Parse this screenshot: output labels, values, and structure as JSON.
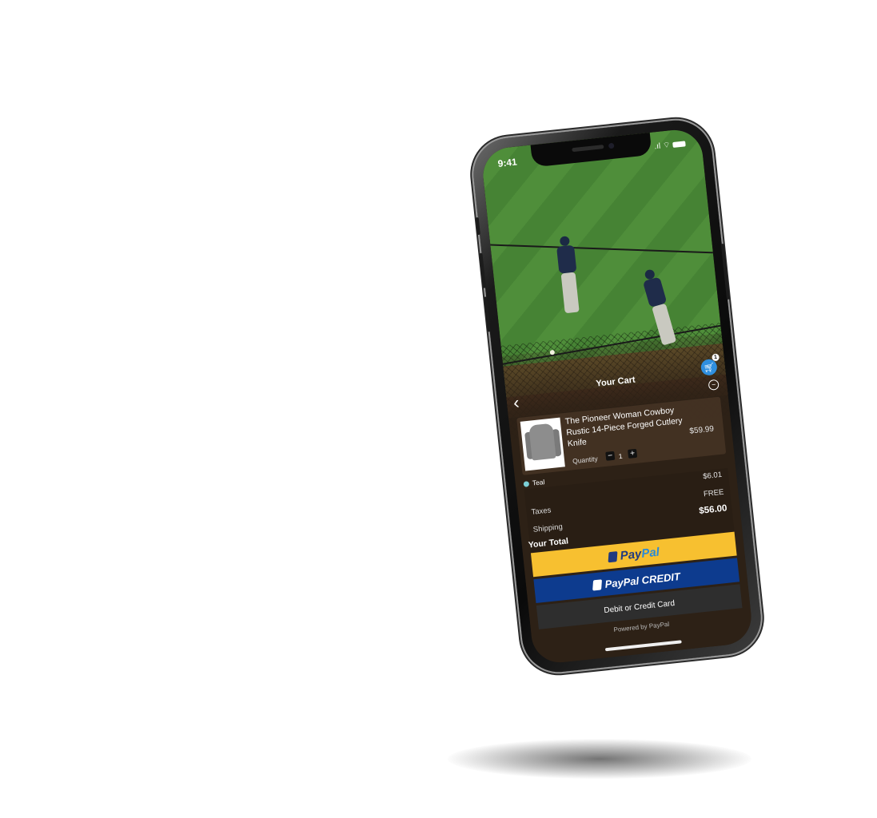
{
  "status_bar": {
    "time": "9:41",
    "signal": ".ıl",
    "wifi": "wifi-icon"
  },
  "cart": {
    "title": "Your Cart",
    "badge_count": "1",
    "item": {
      "name": "The Pioneer Woman Cowboy Rustic 14-Piece Forged Cutlery Knife",
      "quantity_label": "Quantity",
      "quantity": "1",
      "minus": "−",
      "plus": "+",
      "price": "$59.99",
      "color": "Teal",
      "color_hex": "#7ccfd6"
    },
    "summary": {
      "taxes_label": "Taxes",
      "taxes_value": "$6.01",
      "shipping_label": "Shipping",
      "shipping_value": "FREE",
      "total_label": "Your Total",
      "total_value": "$56.00"
    }
  },
  "payment": {
    "paypal_pay": "Pay",
    "paypal_pal": "Pal",
    "credit": "PayPal CREDIT",
    "card": "Debit or Credit Card",
    "powered": "Powered by PayPal"
  },
  "colors": {
    "paypal_yellow": "#f7c030",
    "paypal_blue": "#0d3b8e",
    "fab_blue": "#2f8fe0"
  }
}
